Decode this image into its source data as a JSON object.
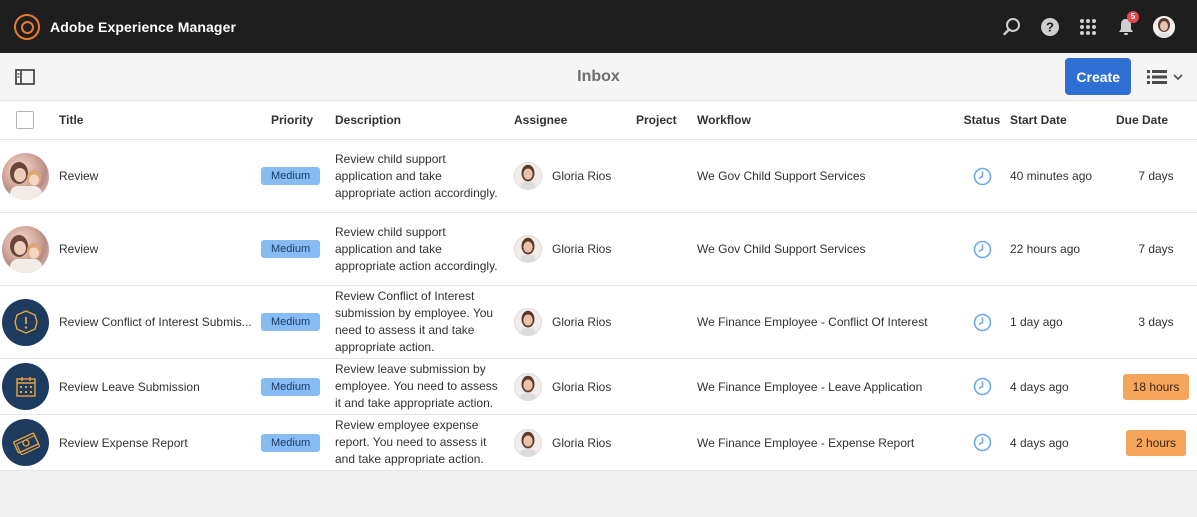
{
  "shell": {
    "title": "Adobe Experience Manager",
    "notification_count": "5"
  },
  "actionbar": {
    "page_title": "Inbox",
    "create_label": "Create"
  },
  "columns": {
    "title": "Title",
    "priority": "Priority",
    "description": "Description",
    "assignee": "Assignee",
    "project": "Project",
    "workflow": "Workflow",
    "status": "Status",
    "start_date": "Start Date",
    "due_date": "Due Date"
  },
  "rows": [
    {
      "title": "Review",
      "priority": "Medium",
      "description": "Review child support application and take appropriate action accordingly.",
      "assignee": "Gloria Rios",
      "project": "",
      "workflow": "We Gov Child Support Services",
      "start_date": "40 minutes ago",
      "due_date": "7 days",
      "thumb": "photo"
    },
    {
      "title": "Review",
      "priority": "Medium",
      "description": "Review child support application and take appropriate action accordingly.",
      "assignee": "Gloria Rios",
      "project": "",
      "workflow": "We Gov Child Support Services",
      "start_date": "22 hours ago",
      "due_date": "7 days",
      "thumb": "photo"
    },
    {
      "title": "Review Conflict of Interest Submis...",
      "priority": "Medium",
      "description": "Review Conflict of Interest submission by employee. You need to assess it and take appropriate action.",
      "assignee": "Gloria Rios",
      "project": "",
      "workflow": "We Finance Employee - Conflict Of Interest",
      "start_date": "1 day ago",
      "due_date": "3 days",
      "thumb": "alert"
    },
    {
      "title": "Review Leave Submission",
      "priority": "Medium",
      "description": "Review leave submission by employee. You need to assess it and take appropriate action.",
      "assignee": "Gloria Rios",
      "project": "",
      "workflow": "We Finance Employee - Leave Application",
      "start_date": "4 days ago",
      "due_date": "18 hours",
      "thumb": "calendar"
    },
    {
      "title": "Review Expense Report",
      "priority": "Medium",
      "description": "Review employee expense report. You need to assess it and take appropriate action.",
      "assignee": "Gloria Rios",
      "project": "",
      "workflow": "We Finance Employee - Expense Report",
      "start_date": "4 days ago",
      "due_date": "2 hours",
      "thumb": "money"
    }
  ],
  "colors": {
    "shell_bg": "#1e1e1e",
    "accent": "#2d6fd2",
    "priority_pill": "#86bbf3",
    "due_urgent": "#f5a65b",
    "status_icon": "#6aa9ea"
  }
}
